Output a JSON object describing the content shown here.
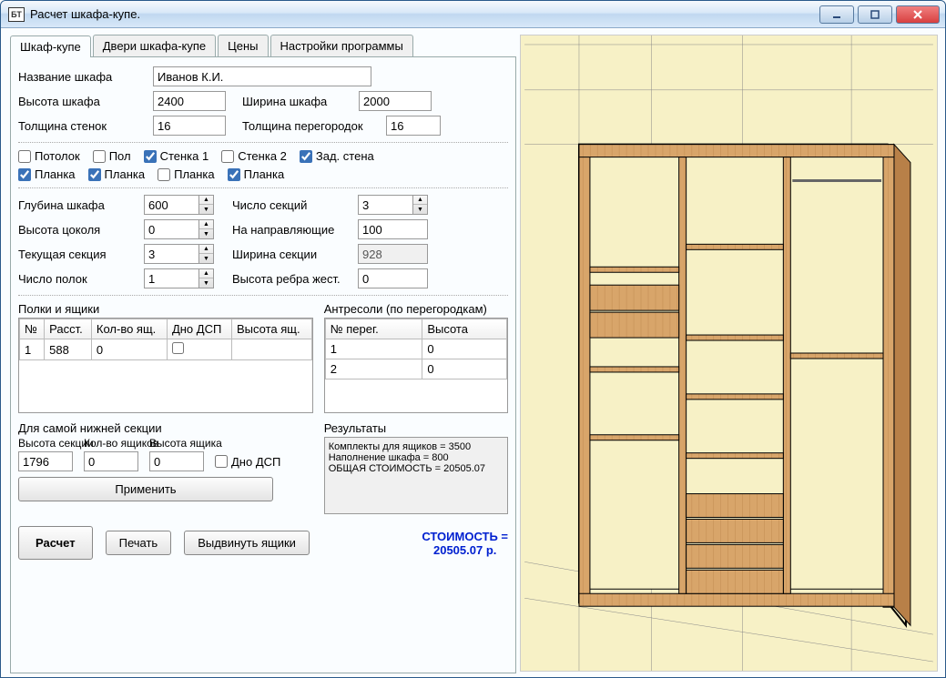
{
  "window": {
    "title": "Расчет шкафа-купе."
  },
  "tabs": [
    "Шкаф-купе",
    "Двери шкафа-купе",
    "Цены",
    "Настройки программы"
  ],
  "activeTab": 0,
  "fields": {
    "nameLabel": "Название шкафа",
    "name": "Иванов К.И.",
    "heightLabel": "Высота шкафа",
    "height": "2400",
    "widthLabel": "Ширина шкафа",
    "width": "2000",
    "wallThickLabel": "Толщина стенок",
    "wallThick": "16",
    "partThickLabel": "Толщина перегородок",
    "partThick": "16",
    "depthLabel": "Глубина шкафа",
    "depth": "600",
    "sectionsLabel": "Число секций",
    "sections": "3",
    "plinthLabel": "Высота цоколя",
    "plinth": "0",
    "railLabel": "На направляющие",
    "rail": "100",
    "curSectionLabel": "Текущая секция",
    "curSection": "3",
    "secWidthLabel": "Ширина секции",
    "secWidth": "928",
    "shelvesLabel": "Число полок",
    "shelves": "1",
    "ribLabel": "Высота ребра жест.",
    "rib": "0"
  },
  "checks": {
    "ceiling": {
      "label": "Потолок",
      "checked": false
    },
    "floor": {
      "label": "Пол",
      "checked": false
    },
    "wall1": {
      "label": "Стенка 1",
      "checked": true
    },
    "wall2": {
      "label": "Стенка 2",
      "checked": false
    },
    "back": {
      "label": "Зад. стена",
      "checked": true
    },
    "plank1": {
      "label": "Планка",
      "checked": true
    },
    "plank2": {
      "label": "Планка",
      "checked": true
    },
    "plank3": {
      "label": "Планка",
      "checked": false
    },
    "plank4": {
      "label": "Планка",
      "checked": true
    }
  },
  "shelvesGroup": {
    "title": "Полки и ящики",
    "headers": [
      "№",
      "Расст.",
      "Кол-во ящ.",
      "Дно ДСП",
      "Высота ящ."
    ],
    "rows": [
      {
        "n": "1",
        "dist": "588",
        "count": "0",
        "dsp": false,
        "h": ""
      }
    ]
  },
  "mezz": {
    "title": "Антресоли (по перегородкам)",
    "headers": [
      "№ перег.",
      "Высота"
    ],
    "rows": [
      {
        "n": "1",
        "h": "0"
      },
      {
        "n": "2",
        "h": "0"
      }
    ]
  },
  "bottomSection": {
    "title": "Для самой нижней секции",
    "hLabel": "Высота секции",
    "h": "1796",
    "cntLabel": "Кол-во ящиков",
    "cnt": "0",
    "bhLabel": "Высота ящика",
    "bh": "0",
    "dspLabel": "Дно ДСП",
    "dsp": false,
    "applyLabel": "Применить"
  },
  "resultsTitle": "Результаты",
  "resultsText": "Комплекты для ящиков       = 3500\nНаполнение шкафа             = 800\nОБЩАЯ СТОИМОСТЬ          =    20505.07",
  "buttons": {
    "calc": "Расчет",
    "print": "Печать",
    "pullout": "Выдвинуть ящики"
  },
  "price": {
    "line1": "СТОИМОСТЬ =",
    "line2": "20505.07 р."
  }
}
